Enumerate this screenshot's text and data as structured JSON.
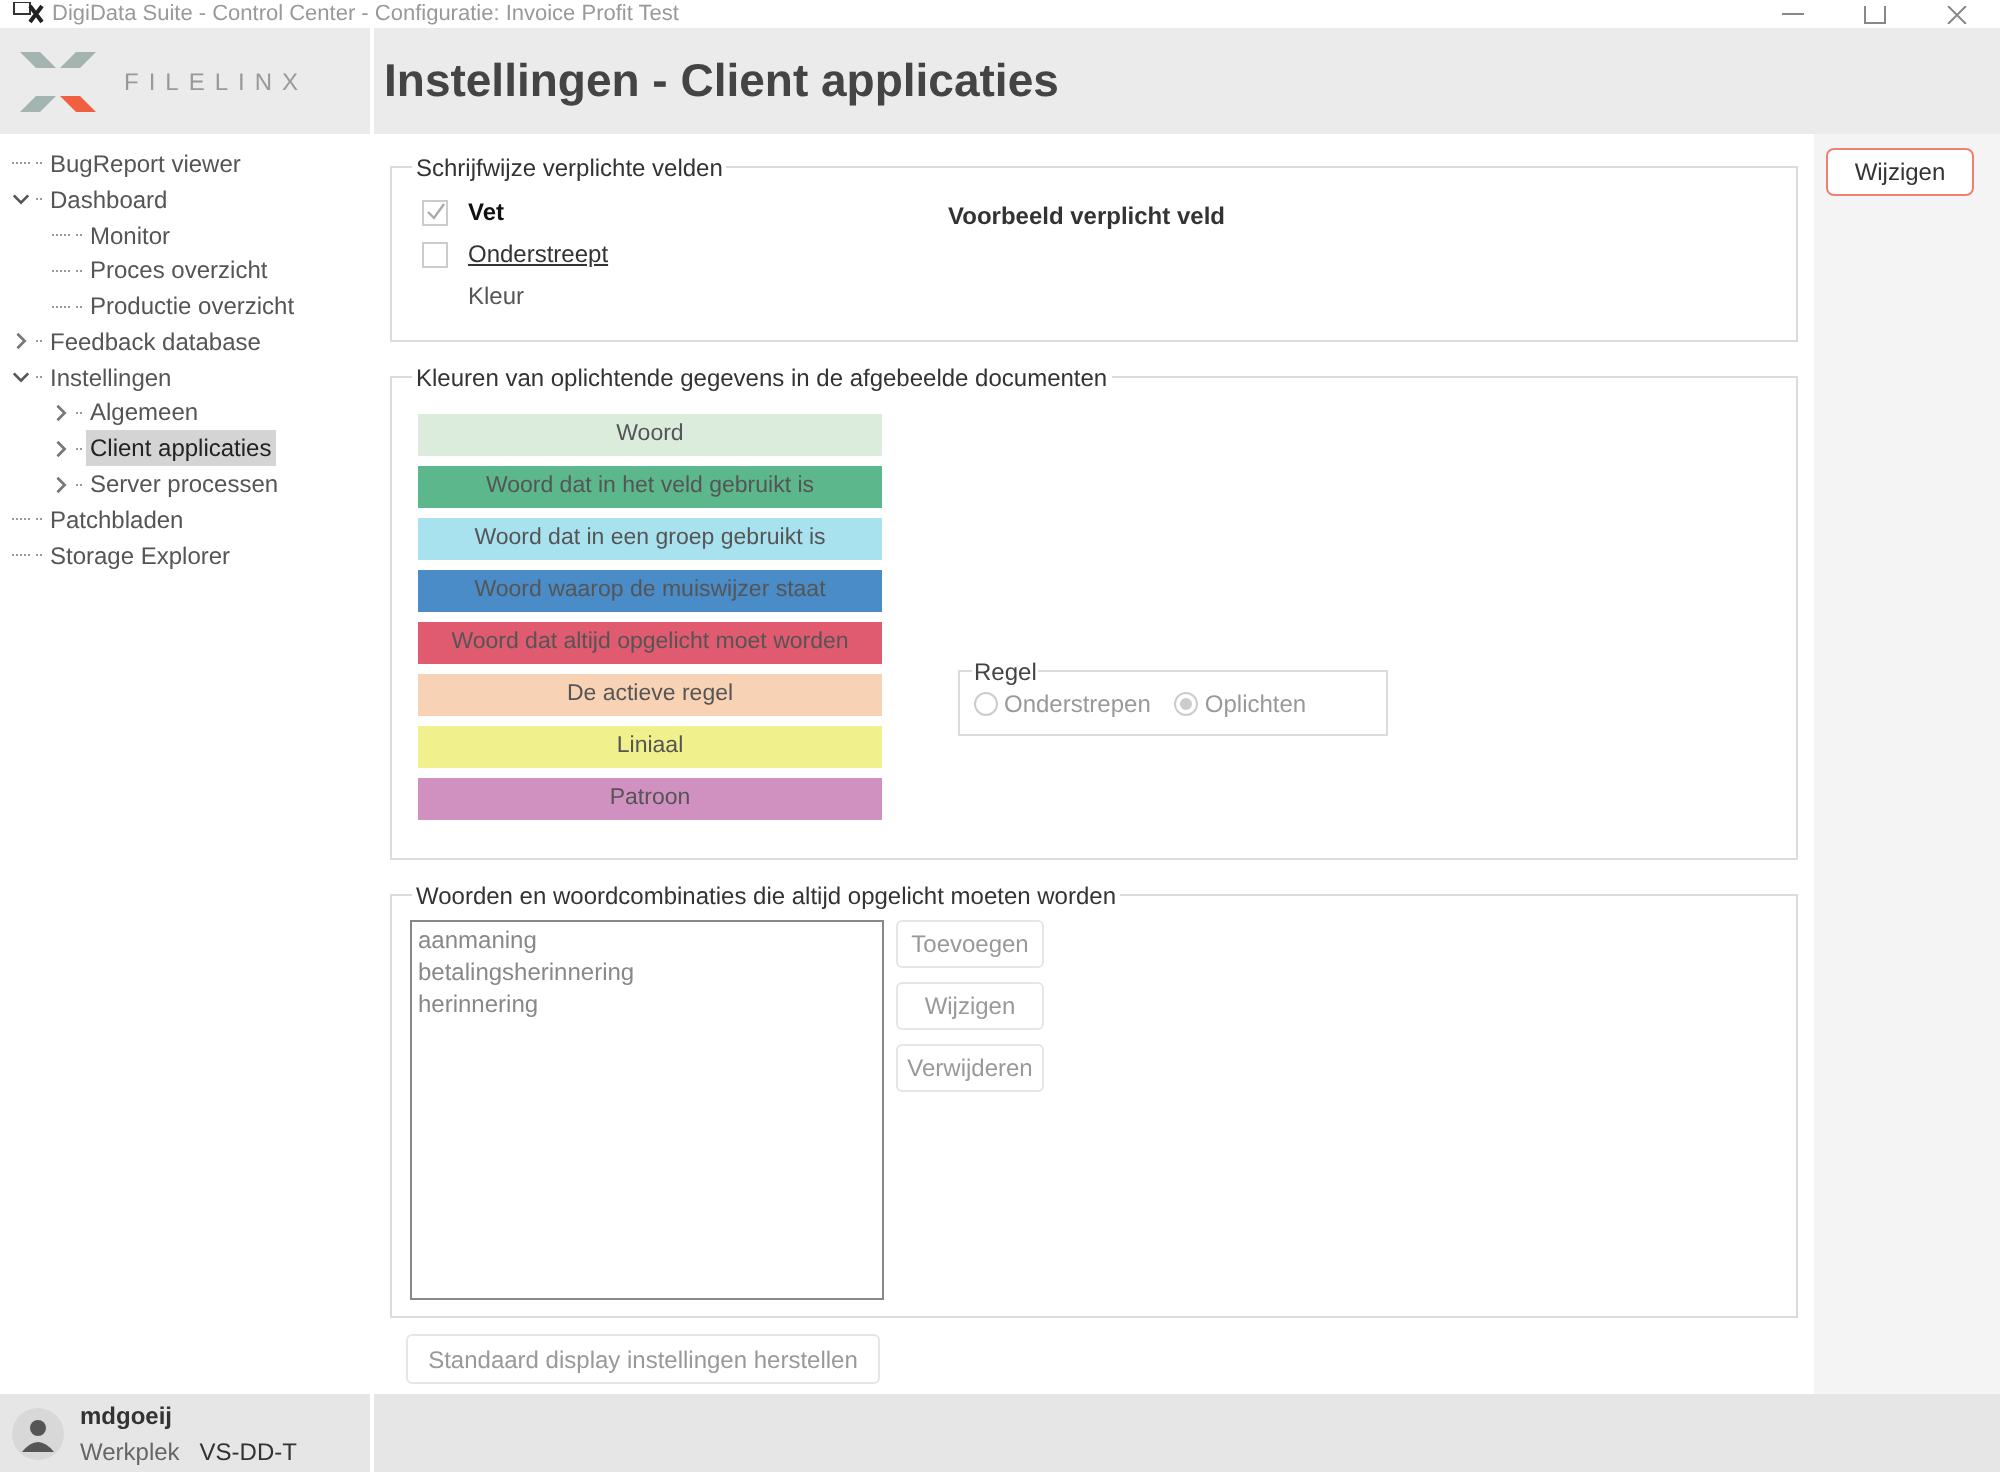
{
  "window": {
    "title": "DigiData Suite - Control Center - Configuratie: Invoice Profit Test"
  },
  "logo": {
    "text": "FILELINX"
  },
  "page_title": "Instellingen - Client applicaties",
  "sidebar": {
    "items": [
      {
        "label": "BugReport viewer",
        "selected": false
      },
      {
        "label": "Dashboard",
        "selected": false,
        "expanded": true,
        "children": [
          {
            "label": "Monitor",
            "selected": false
          },
          {
            "label": "Proces overzicht",
            "selected": false
          },
          {
            "label": "Productie overzicht",
            "selected": false
          }
        ]
      },
      {
        "label": "Feedback database",
        "selected": false,
        "expanded": false
      },
      {
        "label": "Instellingen",
        "selected": false,
        "expanded": true,
        "children": [
          {
            "label": "Algemeen",
            "selected": false,
            "expanded": false
          },
          {
            "label": "Client applicaties",
            "selected": true,
            "expanded": false
          },
          {
            "label": "Server processen",
            "selected": false,
            "expanded": false
          }
        ]
      },
      {
        "label": "Patchbladen",
        "selected": false
      },
      {
        "label": "Storage Explorer",
        "selected": false
      }
    ]
  },
  "user": {
    "name": "mdgoeij",
    "workstation_label": "Werkplek",
    "workstation": "VS-DD-T"
  },
  "required_fields": {
    "title": "Schrijfwijze verplichte velden",
    "options": [
      {
        "kind": "checkbox",
        "label": "Vet",
        "checked": true
      },
      {
        "kind": "checkbox",
        "label": "Onderstreept",
        "checked": false
      },
      {
        "kind": "text",
        "label": "Kleur"
      }
    ],
    "example": "Voorbeeld verplicht veld"
  },
  "highlight_colors": {
    "title": "Kleuren van oplichtende gegevens in de afgebeelde documenten",
    "swatches": [
      {
        "label": "Woord",
        "color": "#dcecdc"
      },
      {
        "label": "Woord dat in het veld gebruikt is",
        "color": "#5cb88c"
      },
      {
        "label": "Woord dat in een groep gebruikt is",
        "color": "#a8e2ef"
      },
      {
        "label": "Woord waarop de muiswijzer staat",
        "color": "#4a8cc8"
      },
      {
        "label": "Woord dat altijd opgelicht moet worden",
        "color": "#e05a70"
      },
      {
        "label": "De actieve regel",
        "color": "#f8d2b4"
      },
      {
        "label": "Liniaal",
        "color": "#f0f08c"
      },
      {
        "label": "Patroon",
        "color": "#d090c0"
      }
    ],
    "rule": {
      "title": "Regel",
      "options": [
        {
          "label": "Onderstrepen",
          "selected": false
        },
        {
          "label": "Oplichten",
          "selected": true
        }
      ]
    }
  },
  "words": {
    "title": "Woorden en woordcombinaties die altijd opgelicht moeten worden",
    "items": [
      "aanmaning",
      "betalingsherinnering",
      "herinnering"
    ],
    "buttons": [
      {
        "label": "Toevoegen",
        "disabled": true
      },
      {
        "label": "Wijzigen",
        "disabled": true
      },
      {
        "label": "Verwijderen",
        "disabled": true
      }
    ]
  },
  "reset_button": {
    "label": "Standaard display instellingen herstellen",
    "disabled": true
  },
  "side_button": {
    "label": "Wijzigen",
    "disabled": false
  }
}
